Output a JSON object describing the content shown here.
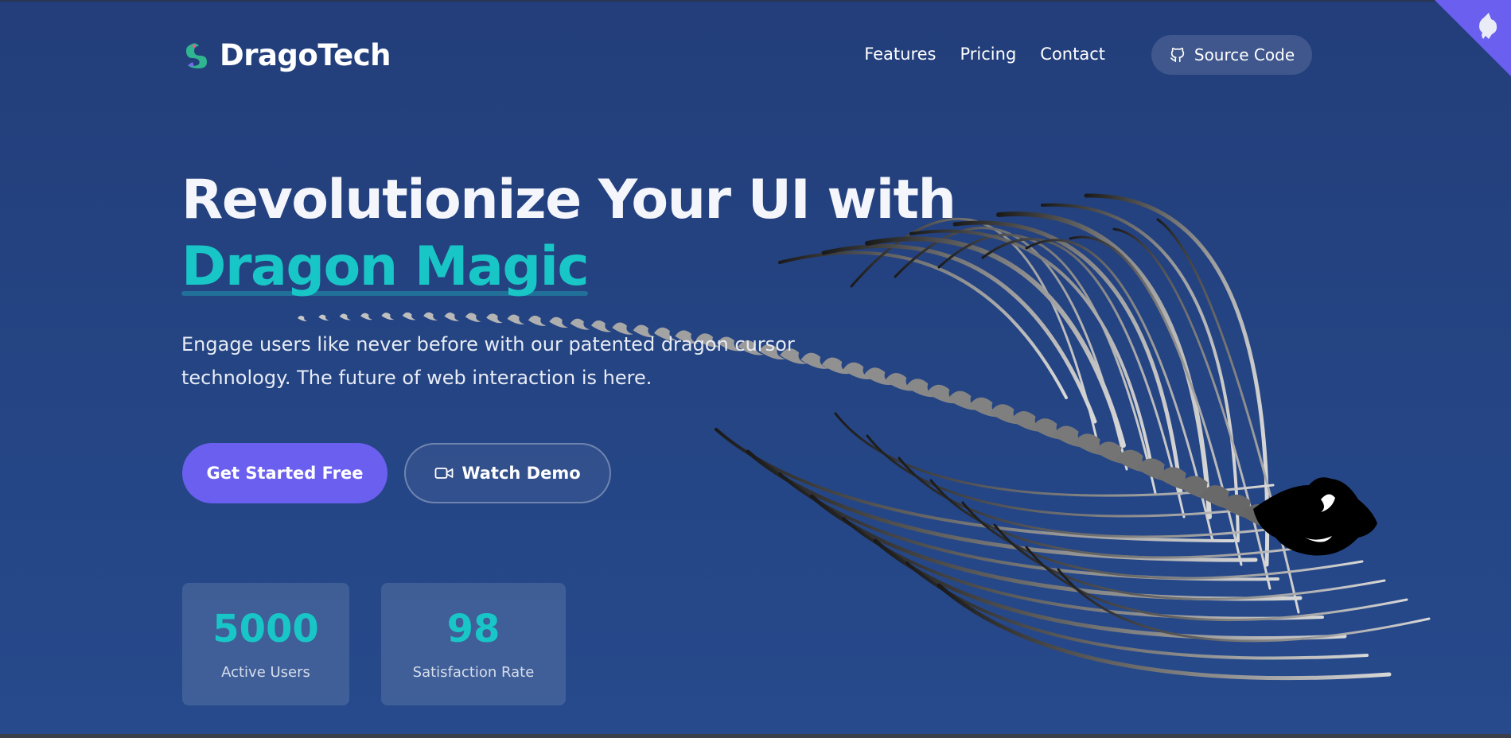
{
  "header": {
    "brand": "DragoTech",
    "nav": [
      "Features",
      "Pricing",
      "Contact"
    ],
    "source_code": "Source Code"
  },
  "hero": {
    "title_line1": "Revolutionize Your UI with",
    "title_accent": "Dragon Magic",
    "subtitle": "Engage users like never before with our patented dragon cursor technology. The future of web interaction is here.",
    "primary_cta": "Get Started Free",
    "secondary_cta": "Watch Demo"
  },
  "stats": [
    {
      "value": "5000",
      "label": "Active Users"
    },
    {
      "value": "98",
      "label": "Satisfaction Rate"
    }
  ],
  "icons": {
    "logo": "dragon-icon",
    "source_code": "github-icon",
    "watch_demo": "video-camera-icon",
    "corner": "github-corner-icon"
  },
  "colors": {
    "background": "#264a8c",
    "accent": "#19c6c7",
    "primary": "#6b5ff0"
  }
}
